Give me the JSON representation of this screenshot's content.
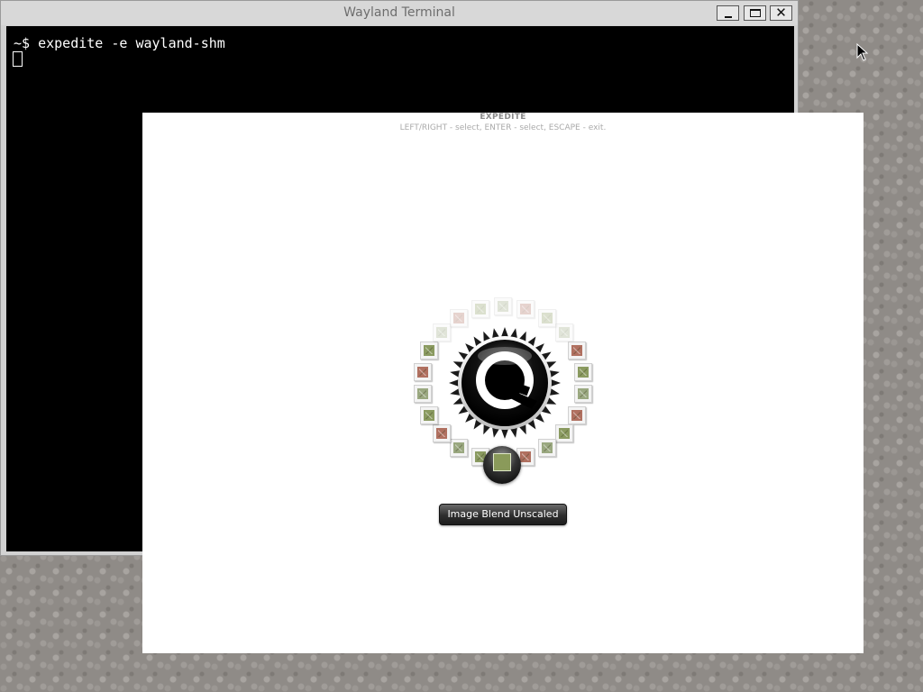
{
  "terminal": {
    "title": "Wayland Terminal",
    "prompt_line": "~$ expedite -e wayland-shm",
    "buttons": {
      "minimize": "minimize-icon",
      "maximize": "maximize-icon",
      "close": "close-icon",
      "close_glyph": "✕"
    }
  },
  "expedite": {
    "title": "EXPEDITE",
    "help": "LEFT/RIGHT - select, ENTER - select, ESCAPE - exit.",
    "selected_test": "Image Blend Unscaled"
  },
  "colors": {
    "terminal_bg": "#000000",
    "window_bg": "#ffffff",
    "label_bg": "#2e2e2e"
  }
}
